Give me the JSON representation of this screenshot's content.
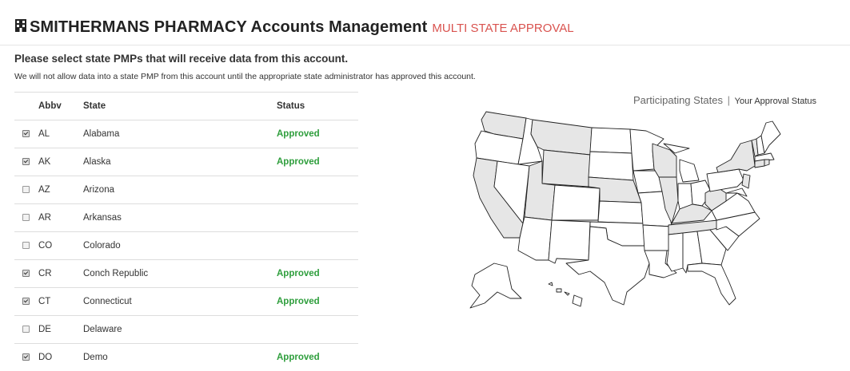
{
  "header": {
    "icon": "building-icon",
    "title": "SMITHERMANS PHARMACY Accounts Management",
    "tag": "MULTI STATE APPROVAL",
    "tag_color": "#d9534f"
  },
  "intro": {
    "heading": "Please select state PMPs that will receive data from this account.",
    "note": "We will not allow data into a state PMP from this account until the appropriate state administrator has approved this account."
  },
  "table": {
    "columns": [
      "",
      "Abbv",
      "State",
      "Status"
    ],
    "rows": [
      {
        "checked": true,
        "abbv": "AL",
        "state": "Alabama",
        "status": "Approved"
      },
      {
        "checked": true,
        "abbv": "AK",
        "state": "Alaska",
        "status": "Approved"
      },
      {
        "checked": false,
        "abbv": "AZ",
        "state": "Arizona",
        "status": ""
      },
      {
        "checked": false,
        "abbv": "AR",
        "state": "Arkansas",
        "status": ""
      },
      {
        "checked": false,
        "abbv": "CO",
        "state": "Colorado",
        "status": ""
      },
      {
        "checked": true,
        "abbv": "CR",
        "state": "Conch Republic",
        "status": "Approved"
      },
      {
        "checked": true,
        "abbv": "CT",
        "state": "Connecticut",
        "status": "Approved"
      },
      {
        "checked": false,
        "abbv": "DE",
        "state": "Delaware",
        "status": ""
      },
      {
        "checked": true,
        "abbv": "DO",
        "state": "Demo",
        "status": "Approved"
      }
    ],
    "approved_color": "#2e9e3c"
  },
  "map": {
    "legend_title": "Participating States",
    "legend_separator": "|",
    "legend_link": "Your Approval Status",
    "highlight_color": "#e6e6e6",
    "outline_color": "#222222"
  }
}
